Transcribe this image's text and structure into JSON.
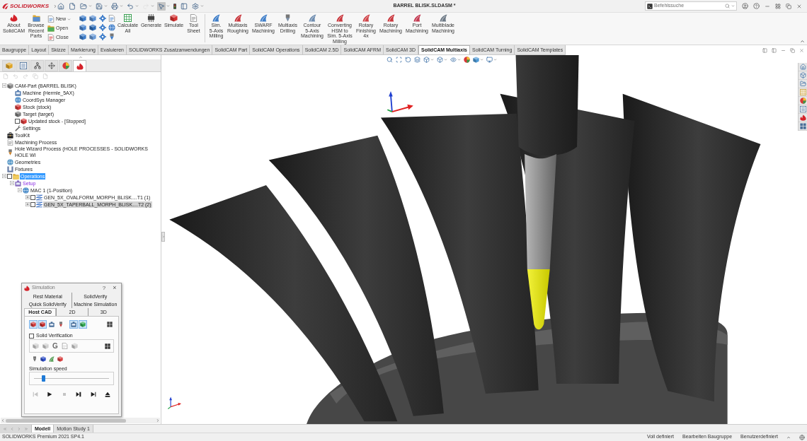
{
  "title_bar": {
    "app": "SOLIDWORKS",
    "document": "BARREL BLISK.SLDASM *",
    "search": {
      "placeholder": "Befehlssuche"
    }
  },
  "quick_access": [
    {
      "on": false,
      "disabled": false
    },
    {
      "on": false,
      "disabled": false
    },
    {
      "on": false,
      "disabled": false
    },
    {
      "on": false,
      "disabled": false
    },
    {
      "on": false,
      "disabled": false
    },
    {
      "on": false,
      "disabled": false
    },
    {
      "on": false,
      "disabled": true
    },
    {
      "on": true,
      "disabled": false
    },
    {
      "on": false,
      "disabled": false
    },
    {
      "on": false,
      "disabled": false
    },
    {
      "on": false,
      "disabled": false
    }
  ],
  "ribbon": {
    "about": "About\nSolidCAM",
    "browse": "Browse\nRecent\nParts",
    "file": [
      {
        "label": "New",
        "dropdown": true
      },
      {
        "label": "Open",
        "dropdown": false
      },
      {
        "label": "Close",
        "dropdown": false
      }
    ],
    "commands": [
      "Calculate\nAll",
      "Generate",
      "Simulate",
      "Tool\nSheet"
    ],
    "multiaxis": [
      "Sim.\n5-Axis\nMilling",
      "Multiaxis\nRoughing",
      "SWARF\nMachining",
      "Multiaxis\nDrilling",
      "Contour\n5-Axis\nMachining",
      "Converting\nHSM to\nSim. 5-Axis\nMilling",
      "Rotary\nFinishing\n4x",
      "Rotary\nMachining",
      "Port\nMachining",
      "Multiblade\nMachining"
    ]
  },
  "tabs": [
    {
      "label": "Baugruppe",
      "selected": false
    },
    {
      "label": "Layout",
      "selected": false
    },
    {
      "label": "Skizze",
      "selected": false
    },
    {
      "label": "Markierung",
      "selected": false
    },
    {
      "label": "Evaluieren",
      "selected": false
    },
    {
      "label": "SOLIDWORKS Zusatzanwendungen",
      "selected": false
    },
    {
      "label": "SolidCAM Part",
      "selected": false
    },
    {
      "label": "SolidCAM Operations",
      "selected": false
    },
    {
      "label": "SolidCAM 2.5D",
      "selected": false
    },
    {
      "label": "SolidCAM AFRM",
      "selected": false
    },
    {
      "label": "SolidCAM 3D",
      "selected": false
    },
    {
      "label": "SolidCAM Multiaxis",
      "selected": true
    },
    {
      "label": "SolidCAM Turning",
      "selected": false
    },
    {
      "label": "SolidCAM Templates",
      "selected": false
    }
  ],
  "panel_tabs": [
    {
      "selected": false
    },
    {
      "selected": false
    },
    {
      "selected": false
    },
    {
      "selected": false
    },
    {
      "selected": false
    },
    {
      "selected": true
    }
  ],
  "feature_tree": [
    {
      "label": "CAM-Part (BARREL BLISK)",
      "kind": "part",
      "selected": false,
      "expanded": true,
      "children": [
        {
          "label": "Machine (Hermle_5AX)",
          "kind": "machine",
          "selected": false
        },
        {
          "label": "CoordSys Manager",
          "kind": "coordsys",
          "selected": false
        },
        {
          "label": "Stock (stock)",
          "kind": "stock",
          "selected": false
        },
        {
          "label": "Target (target)",
          "kind": "target",
          "selected": false
        },
        {
          "label": "Updated stock - [Stopped]",
          "kind": "stock",
          "selected": false,
          "checked": false
        },
        {
          "label": "Settings",
          "kind": "settings",
          "selected": false
        }
      ]
    },
    {
      "label": "ToolKit",
      "kind": "toolkit",
      "selected": false
    },
    {
      "label": "Machining Process",
      "kind": "process",
      "selected": false
    },
    {
      "label": "Hole Wizard Process (HOLE PROCESSES - SOLIDWORKS HOLE WI",
      "kind": "hole",
      "selected": false
    },
    {
      "label": "Geometries",
      "kind": "geometry",
      "selected": false
    },
    {
      "label": "Fixtures",
      "kind": "fixture",
      "selected": false
    },
    {
      "label": "Operations",
      "kind": "folder",
      "selected": true,
      "checked": false,
      "expanded": true,
      "children": [
        {
          "label": "Setup",
          "kind": "setup",
          "selected": false,
          "expanded": true,
          "children": [
            {
              "label": "MAC 1 (1-Position)",
              "kind": "mac",
              "selected": false,
              "expanded": true,
              "children": [
                {
                  "label": "GEN_5X_OVALFORM_MORPH_BLISK....T1 (1)",
                  "kind": "operation",
                  "selected": false,
                  "highlighted": false,
                  "checked": false,
                  "expanded": false
                },
                {
                  "label": "GEN_5X_TAPERBALL_MORPH_BLISK....T2 (2)",
                  "kind": "operation",
                  "selected": false,
                  "highlighted": true,
                  "checked": false,
                  "expanded": false
                }
              ]
            }
          ]
        }
      ]
    }
  ],
  "simulation": {
    "title": "Simulation",
    "help": "?",
    "close": "×",
    "tab_rows": [
      [
        {
          "label": "Rest Material",
          "selected": false
        },
        {
          "label": "SolidVerify",
          "selected": false
        }
      ],
      [
        {
          "label": "Quick SolidVerify",
          "selected": false
        },
        {
          "label": "Machine Simulation",
          "selected": false
        }
      ],
      [
        {
          "label": "Host CAD",
          "selected": true
        },
        {
          "label": "2D",
          "selected": false
        },
        {
          "label": "3D",
          "selected": false
        }
      ]
    ],
    "toolbar": [
      {
        "on": true
      },
      {
        "on": true
      },
      {
        "on": false
      },
      {
        "on": false
      },
      {
        "on": true
      },
      {
        "on": true
      },
      {
        "on": false
      }
    ],
    "solid_verification": {
      "label": "Solid Verification",
      "checked": false,
      "glyph": "G"
    },
    "speed": {
      "label": "Simulation speed",
      "level": 0.12
    },
    "playback": [
      {
        "disabled": true
      },
      {
        "disabled": false
      },
      {
        "disabled": true
      },
      {
        "disabled": false
      },
      {
        "disabled": false
      },
      {
        "disabled": false
      }
    ]
  },
  "bottom_tabs": [
    {
      "label": "Modell",
      "selected": true
    },
    {
      "label": "Motion Study 1",
      "selected": false
    }
  ],
  "status_bar": {
    "product": "SOLIDWORKS Premium 2021 SP4.1",
    "fields": [
      "Voll definiert",
      "Bearbeiten Baugruppe",
      "Benutzerdefiniert"
    ]
  }
}
